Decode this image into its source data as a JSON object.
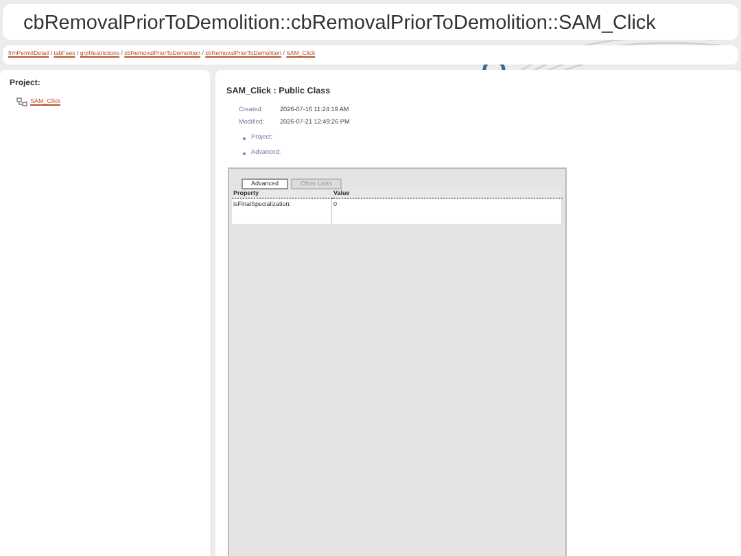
{
  "header": {
    "title": "cbRemovalPriorToDemolition::cbRemovalPriorToDemolition::SAM_Click"
  },
  "breadcrumb": {
    "separator": "/",
    "items": [
      "frmPermitDetail",
      "tabFees",
      "grpRestrictions",
      "cbRemovalPriorToDemolition",
      "cbRemovalPriorToDemolition",
      "SAM_Click"
    ]
  },
  "sidebar": {
    "heading": "Project:",
    "items": [
      {
        "label": "SAM_Click"
      }
    ]
  },
  "main": {
    "title": "SAM_Click : Public Class",
    "meta": [
      {
        "label": "Created:",
        "value": "2026-07-16 11:24:19 AM"
      },
      {
        "label": "Modified:",
        "value": "2026-07-21 12:49:26 PM"
      }
    ],
    "links": [
      "Project:",
      "Advanced:"
    ],
    "tabs": [
      {
        "label": "Advanced",
        "selected": true
      },
      {
        "label": "Other Links",
        "selected": false
      }
    ],
    "table": {
      "columns": [
        "Property",
        "Value"
      ],
      "rows": [
        [
          "isFinalSpecialization:",
          "0"
        ]
      ]
    }
  }
}
